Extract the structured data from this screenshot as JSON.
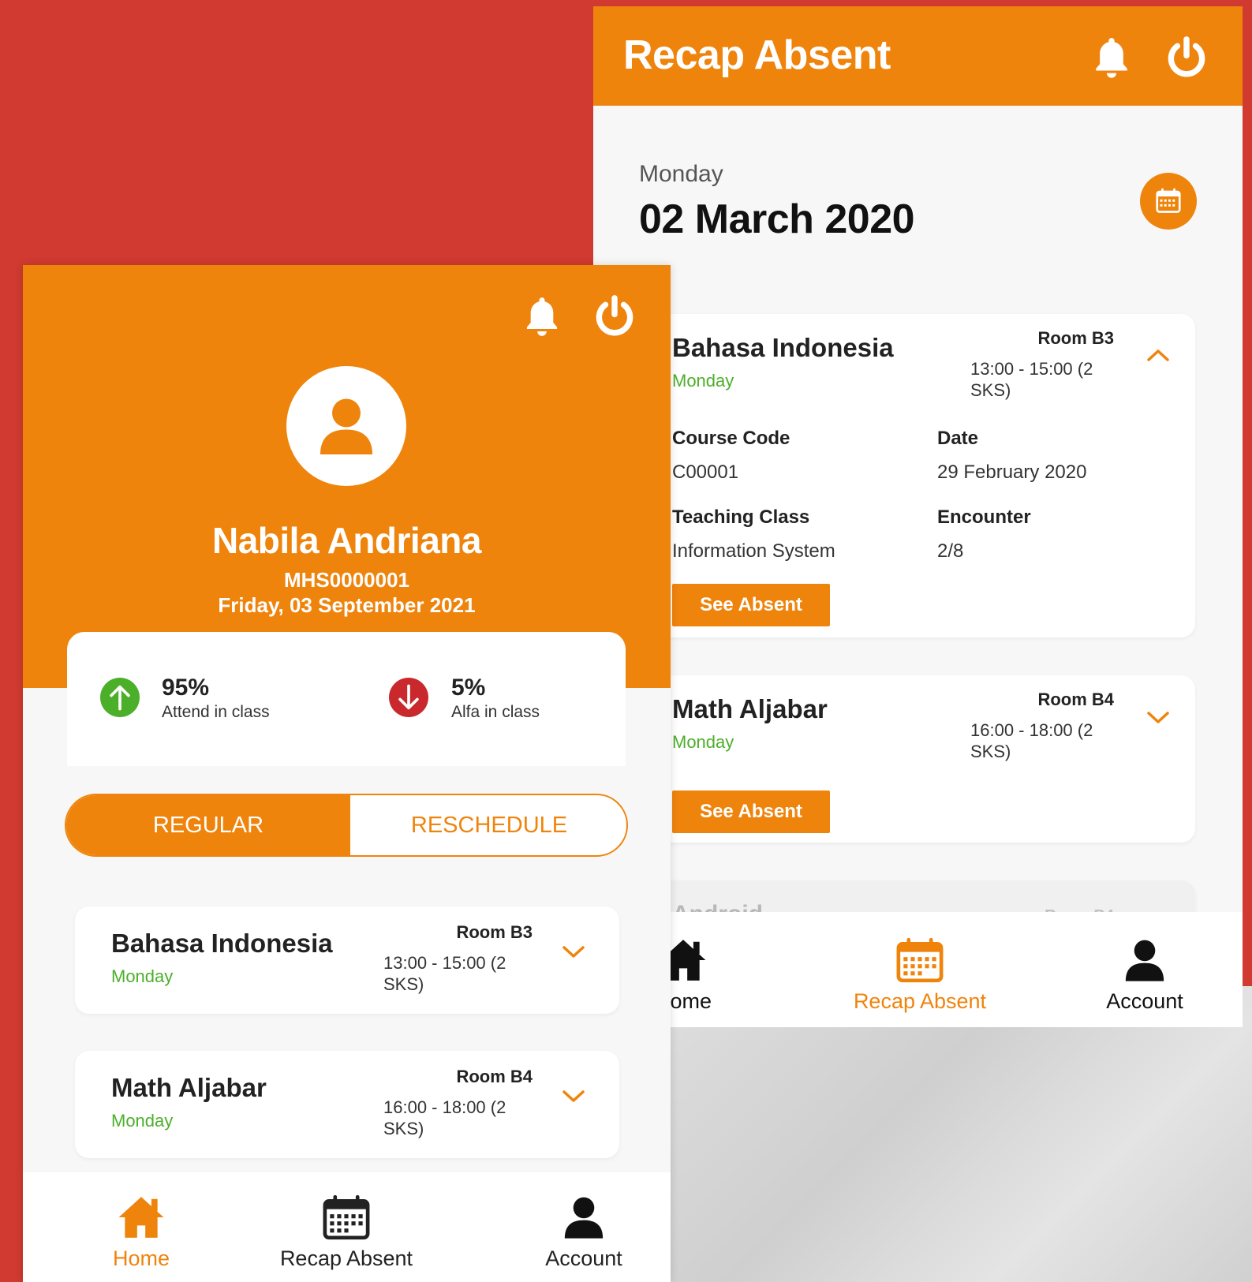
{
  "colors": {
    "accent": "#ef840d",
    "green": "#4caf2a",
    "red": "#c9282d",
    "background": "#d03a30"
  },
  "recap_screen": {
    "title": "Recap Absent",
    "day_name": "Monday",
    "date": "02 March 2020",
    "courses": [
      {
        "name": "Bahasa Indonesia",
        "day": "Monday",
        "room": "Room B3",
        "time": "13:00 - 15:00 (2 SKS)",
        "expanded": true,
        "course_code_label": "Course Code",
        "course_code": "C00001",
        "date_label": "Date",
        "date": "29 February 2020",
        "teaching_class_label": "Teaching Class",
        "teaching_class": "Information System",
        "encounter_label": "Encounter",
        "encounter": "2/8",
        "button": "See Absent"
      },
      {
        "name": "Math Aljabar",
        "day": "Monday",
        "room": "Room B4",
        "time": "16:00 - 18:00 (2 SKS)",
        "expanded": false,
        "button": "See Absent"
      },
      {
        "name": "Android",
        "room": "Room B4"
      }
    ],
    "nav": {
      "home": "Home",
      "recap": "Recap Absent",
      "account": "Account",
      "active": "recap"
    }
  },
  "home_screen": {
    "user_name": "Nabila Andriana",
    "user_id": "MHS0000001",
    "today": "Friday, 03 September 2021",
    "stats": {
      "attend_pct": "95%",
      "attend_label": "Attend in class",
      "alfa_pct": "5%",
      "alfa_label": "Alfa in class"
    },
    "tabs": {
      "regular": "REGULAR",
      "reschedule": "RESCHEDULE",
      "active": "regular"
    },
    "courses": [
      {
        "name": "Bahasa Indonesia",
        "day": "Monday",
        "room": "Room B3",
        "time": "13:00 - 15:00 (2 SKS)"
      },
      {
        "name": "Math Aljabar",
        "day": "Monday",
        "room": "Room B4",
        "time": "16:00 - 18:00 (2 SKS)"
      }
    ],
    "nav": {
      "home": "Home",
      "recap": "Recap Absent",
      "account": "Account",
      "active": "home"
    }
  }
}
